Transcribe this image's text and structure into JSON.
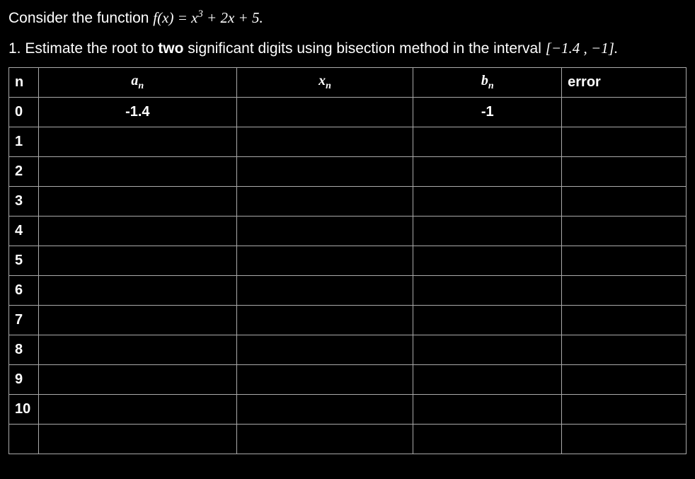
{
  "prompt_prefix": "Consider the function  ",
  "func_lhs": "f(x) = x",
  "func_exp": "3",
  "func_rhs": " + 2x + 5.",
  "question_prefix": "1. Estimate the root to ",
  "question_bold": "two",
  "question_mid": " significant digits using bisection method in the interval ",
  "interval": "[−1.4 ,  −1].",
  "headers": {
    "n": "n",
    "a_base": "a",
    "a_sub": "n",
    "x_base": "x",
    "x_sub": "n",
    "b_base": "b",
    "b_sub": "n",
    "error": "error"
  },
  "rows": [
    {
      "n": "0",
      "a": "-1.4",
      "x": "",
      "b": "-1",
      "e": ""
    },
    {
      "n": "1",
      "a": "",
      "x": "",
      "b": "",
      "e": ""
    },
    {
      "n": "2",
      "a": "",
      "x": "",
      "b": "",
      "e": ""
    },
    {
      "n": "3",
      "a": "",
      "x": "",
      "b": "",
      "e": ""
    },
    {
      "n": "4",
      "a": "",
      "x": "",
      "b": "",
      "e": ""
    },
    {
      "n": "5",
      "a": "",
      "x": "",
      "b": "",
      "e": ""
    },
    {
      "n": "6",
      "a": "",
      "x": "",
      "b": "",
      "e": ""
    },
    {
      "n": "7",
      "a": "",
      "x": "",
      "b": "",
      "e": ""
    },
    {
      "n": "8",
      "a": "",
      "x": "",
      "b": "",
      "e": ""
    },
    {
      "n": "9",
      "a": "",
      "x": "",
      "b": "",
      "e": ""
    },
    {
      "n": "10",
      "a": "",
      "x": "",
      "b": "",
      "e": ""
    },
    {
      "n": "",
      "a": "",
      "x": "",
      "b": "",
      "e": ""
    }
  ]
}
